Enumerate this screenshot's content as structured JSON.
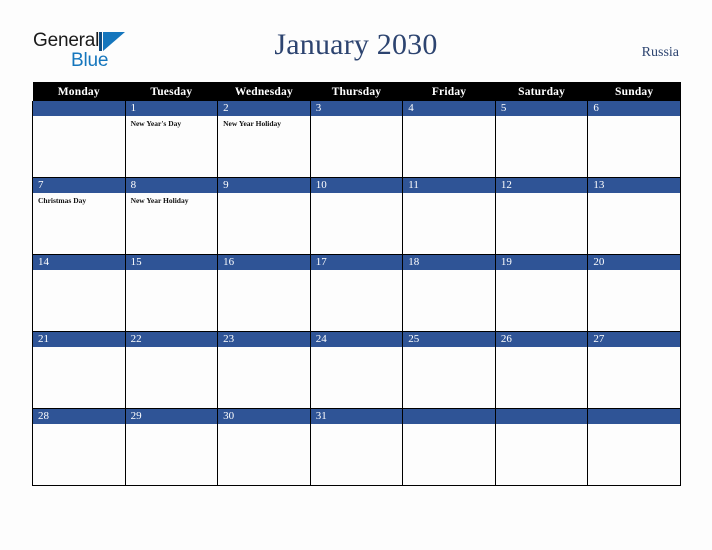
{
  "logo": {
    "word1": "General",
    "word2": "Blue",
    "flag_icon": "triangle-flag-icon",
    "colors": {
      "bar": "#0f4c81",
      "triangle": "#1576bd",
      "word1": "#1a1a1a",
      "word2": "#1576bd"
    }
  },
  "header": {
    "title": "January 2030",
    "country": "Russia",
    "title_color": "#2d4470"
  },
  "theme": {
    "background": "#fdfdfd",
    "header_row_bg": "#000000",
    "header_row_text": "#ffffff",
    "daynum_bg": "#2f5496",
    "daynum_text": "#ffffff",
    "grid_line": "#000000"
  },
  "calendar": {
    "weekday_headers": [
      "Monday",
      "Tuesday",
      "Wednesday",
      "Thursday",
      "Friday",
      "Saturday",
      "Sunday"
    ],
    "weeks": [
      [
        {
          "day": "",
          "events": []
        },
        {
          "day": "1",
          "events": [
            "New Year's Day"
          ]
        },
        {
          "day": "2",
          "events": [
            "New Year Holiday"
          ]
        },
        {
          "day": "3",
          "events": []
        },
        {
          "day": "4",
          "events": []
        },
        {
          "day": "5",
          "events": []
        },
        {
          "day": "6",
          "events": []
        }
      ],
      [
        {
          "day": "7",
          "events": [
            "Christmas Day"
          ]
        },
        {
          "day": "8",
          "events": [
            "New Year Holiday"
          ]
        },
        {
          "day": "9",
          "events": []
        },
        {
          "day": "10",
          "events": []
        },
        {
          "day": "11",
          "events": []
        },
        {
          "day": "12",
          "events": []
        },
        {
          "day": "13",
          "events": []
        }
      ],
      [
        {
          "day": "14",
          "events": []
        },
        {
          "day": "15",
          "events": []
        },
        {
          "day": "16",
          "events": []
        },
        {
          "day": "17",
          "events": []
        },
        {
          "day": "18",
          "events": []
        },
        {
          "day": "19",
          "events": []
        },
        {
          "day": "20",
          "events": []
        }
      ],
      [
        {
          "day": "21",
          "events": []
        },
        {
          "day": "22",
          "events": []
        },
        {
          "day": "23",
          "events": []
        },
        {
          "day": "24",
          "events": []
        },
        {
          "day": "25",
          "events": []
        },
        {
          "day": "26",
          "events": []
        },
        {
          "day": "27",
          "events": []
        }
      ],
      [
        {
          "day": "28",
          "events": []
        },
        {
          "day": "29",
          "events": []
        },
        {
          "day": "30",
          "events": []
        },
        {
          "day": "31",
          "events": []
        },
        {
          "day": "",
          "events": []
        },
        {
          "day": "",
          "events": []
        },
        {
          "day": "",
          "events": []
        }
      ]
    ]
  }
}
